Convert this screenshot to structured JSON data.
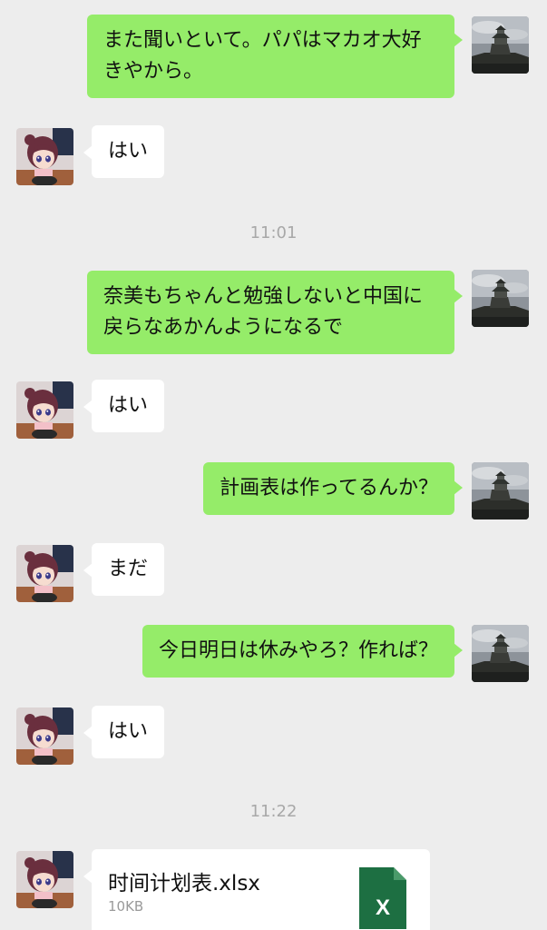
{
  "messages": [
    {
      "side": "out",
      "text": "また聞いといて。パパはマカオ大好きやから。"
    },
    {
      "side": "in",
      "text": "はい"
    },
    {
      "timestamp": "11:01"
    },
    {
      "side": "out",
      "text": "奈美もちゃんと勉強しないと中国に戻らなあかんようになるで"
    },
    {
      "side": "in",
      "text": "はい"
    },
    {
      "side": "out",
      "text": "計画表は作ってるんか？"
    },
    {
      "side": "in",
      "text": "まだ"
    },
    {
      "side": "out",
      "text": "今日明日は休みやろ？作れば？"
    },
    {
      "side": "in",
      "text": "はい"
    },
    {
      "timestamp": "11:22"
    },
    {
      "side": "in",
      "file": {
        "name": "时间计划表.xlsx",
        "size": "10KB",
        "icon": "excel-file-icon",
        "icon_letter": "X"
      }
    }
  ],
  "colors": {
    "background": "#ededed",
    "outgoing_bubble": "#95ec69",
    "incoming_bubble": "#ffffff",
    "timestamp_text": "#a8a8a8",
    "excel_green": "#1d6f42"
  },
  "avatars": {
    "self": "castle-photo-avatar",
    "contact": "anime-girl-avatar"
  }
}
